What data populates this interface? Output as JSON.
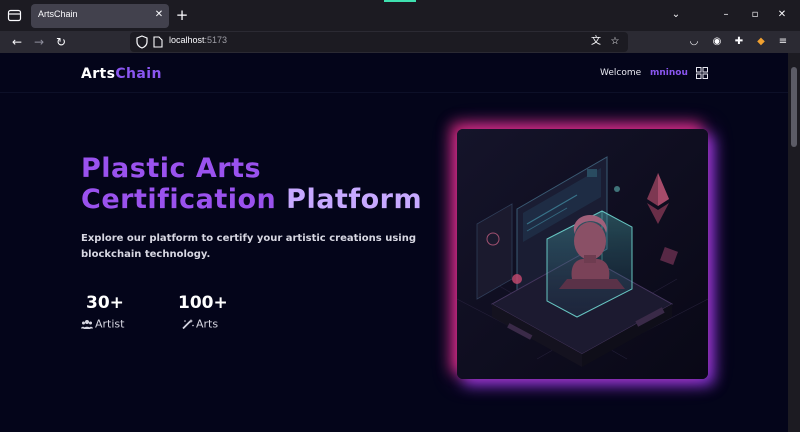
{
  "browser": {
    "tab_title": "ArtsChain",
    "url_host": "localhost",
    "url_port": ":5173"
  },
  "site": {
    "logo_part1": "Arts",
    "logo_part2": "Chain",
    "welcome": "Welcome",
    "username": "mninou"
  },
  "hero": {
    "title_line1": "Plastic Arts",
    "title_line2a": "Certification",
    "title_line2b": "Platform",
    "description": "Explore our platform to certify your artistic creations using blockchain technology."
  },
  "stats": [
    {
      "value": "30+",
      "label": "Artist",
      "icon": "users-icon"
    },
    {
      "value": "100+",
      "label": "Arts",
      "icon": "magic-wand-icon"
    }
  ],
  "colors": {
    "accent_purple": "#8a56f0",
    "title_purple": "#9a52ee",
    "title_light": "#c7a9ff",
    "page_bg": "#04051a",
    "glow_pink": "#e82c80"
  }
}
